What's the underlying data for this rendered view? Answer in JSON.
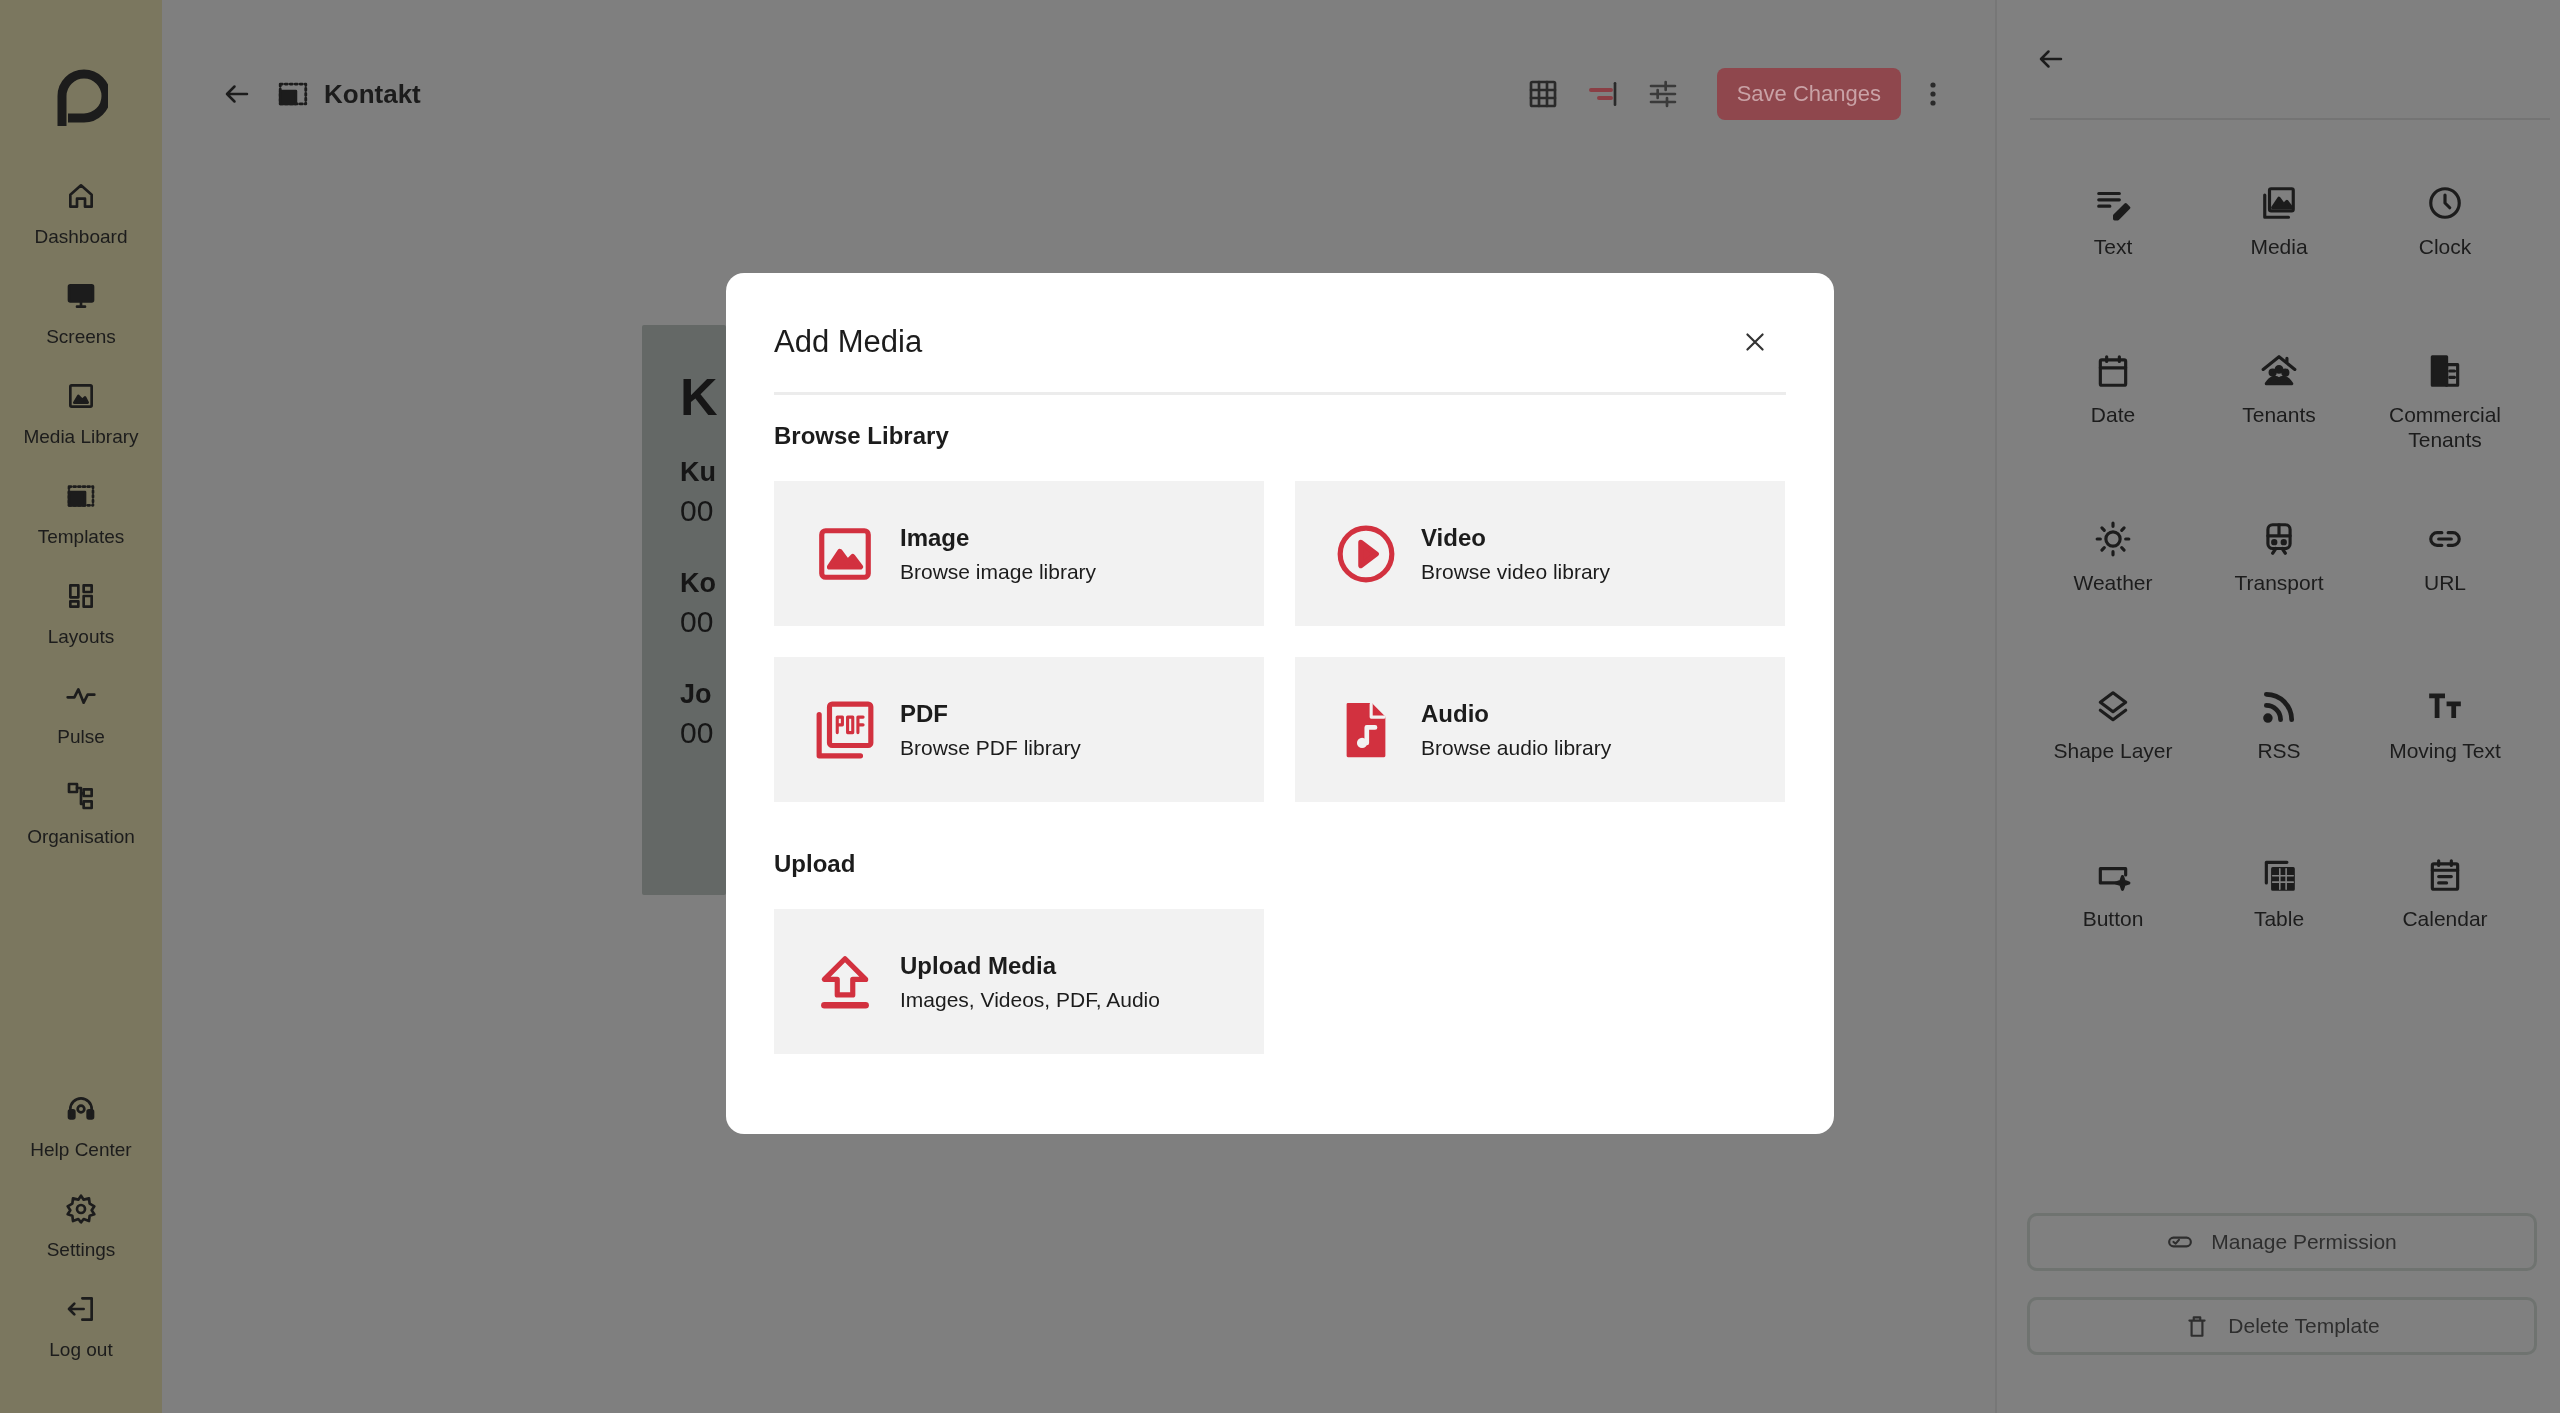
{
  "sidebar": {
    "items": [
      {
        "label": "Dashboard"
      },
      {
        "label": "Screens"
      },
      {
        "label": "Media Library"
      },
      {
        "label": "Templates"
      },
      {
        "label": "Layouts"
      },
      {
        "label": "Pulse"
      },
      {
        "label": "Organisation"
      }
    ],
    "bottom_items": [
      {
        "label": "Help Center"
      },
      {
        "label": "Settings"
      },
      {
        "label": "Log out"
      }
    ]
  },
  "top_bar": {
    "title": "Kontakt",
    "save_button": "Save Changes"
  },
  "canvas": {
    "heading": "K",
    "entries": [
      {
        "label": "Ku",
        "value": "00"
      },
      {
        "label": "Ko",
        "value": "00"
      },
      {
        "label": "Jo",
        "value": "00"
      }
    ]
  },
  "right_panel": {
    "widgets": [
      "Text",
      "Media",
      "Clock",
      "Date",
      "Tenants",
      "Commercial Tenants",
      "Weather",
      "Transport",
      "URL",
      "Shape Layer",
      "RSS",
      "Moving Text",
      "Button",
      "Table",
      "Calendar"
    ],
    "buttons": [
      "Manage Permission",
      "Delete Template"
    ]
  },
  "dialog": {
    "title": "Add Media",
    "sections": [
      {
        "heading": "Browse Library",
        "options": [
          {
            "title": "Image",
            "subtitle": "Browse image library"
          },
          {
            "title": "Video",
            "subtitle": "Browse video library"
          },
          {
            "title": "PDF",
            "subtitle": "Browse PDF library"
          },
          {
            "title": "Audio",
            "subtitle": "Browse audio library"
          }
        ]
      },
      {
        "heading": "Upload",
        "options": [
          {
            "title": "Upload Media",
            "subtitle": "Images, Videos, PDF, Audio"
          }
        ]
      }
    ]
  }
}
